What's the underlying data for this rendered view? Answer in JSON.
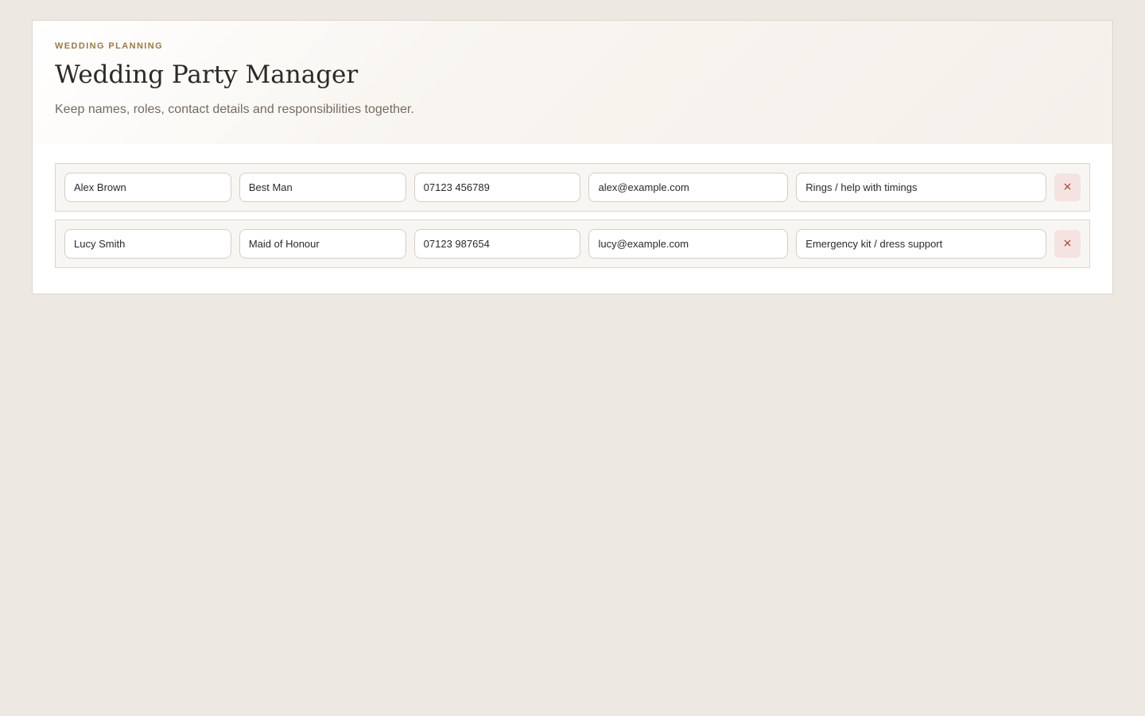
{
  "header": {
    "eyebrow": "WEDDING PLANNING",
    "title": "Wedding Party Manager",
    "subtitle": "Keep names, roles, contact details and responsibilities together."
  },
  "members": [
    {
      "name": "Alex Brown",
      "role": "Best Man",
      "phone": "07123 456789",
      "email": "alex@example.com",
      "responsibilities": "Rings / help with timings",
      "remove_label": "×"
    },
    {
      "name": "Lucy Smith",
      "role": "Maid of Honour",
      "phone": "07123 987654",
      "email": "lucy@example.com",
      "responsibilities": "Emergency kit / dress support",
      "remove_label": "×"
    }
  ],
  "colors": {
    "background": "#ede8e2",
    "accent": "#9a7a45",
    "remove_button_bg": "#f5e3e1",
    "remove_button_fg": "#a83a32"
  },
  "icons": {
    "remove": "close-icon"
  }
}
